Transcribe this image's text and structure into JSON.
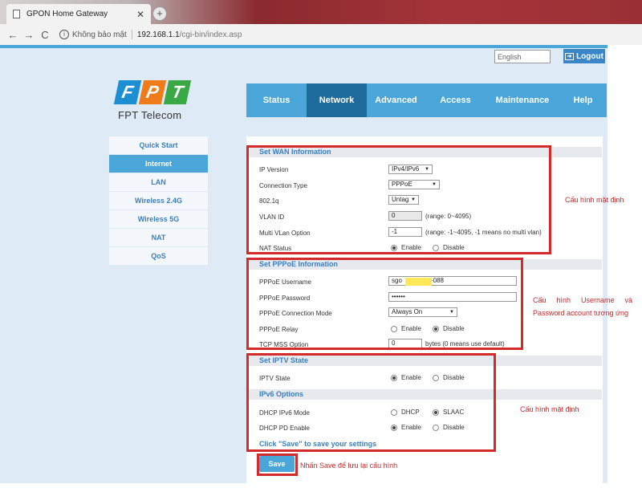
{
  "browser": {
    "tab_title": "GPON Home Gateway",
    "tab_close": "✕",
    "new_tab": "+",
    "back": "←",
    "forward": "→",
    "reload": "C",
    "info": "i",
    "security_text": "Không bảo mật",
    "url_host": "192.168.1.1",
    "url_path": "/cgi-bin/index.asp"
  },
  "header": {
    "language_value": "English",
    "logout_label": "Logout",
    "logo_letters": [
      "F",
      "P",
      "T"
    ],
    "logo_colors": [
      "#1c8fd3",
      "#ef7c1a",
      "#3aa845"
    ],
    "brand_name": "FPT Telecom"
  },
  "nav": {
    "items": [
      {
        "label": "Status"
      },
      {
        "label": "Network"
      },
      {
        "label": "Advanced"
      },
      {
        "label": "Access"
      },
      {
        "label": "Maintenance"
      },
      {
        "label": "Help"
      }
    ],
    "active": "Network"
  },
  "sidebar": {
    "items": [
      {
        "label": "Quick Start"
      },
      {
        "label": "Internet"
      },
      {
        "label": "LAN"
      },
      {
        "label": "Wireless 2.4G"
      },
      {
        "label": "Wireless 5G"
      },
      {
        "label": "NAT"
      },
      {
        "label": "QoS"
      }
    ],
    "active": "Internet"
  },
  "wan": {
    "title": "Set WAN Information",
    "ip_version": {
      "label": "IP Version",
      "value": "IPv4/IPv6"
    },
    "connection_type": {
      "label": "Connection Type",
      "value": "PPPoE"
    },
    "dot1q": {
      "label": "802.1q",
      "value": "Untag"
    },
    "vlan_id": {
      "label": "VLAN ID",
      "value": "0",
      "hint": "(range: 0~4095)"
    },
    "multi_vlan": {
      "label": "Multi VLan Option",
      "value": "-1",
      "hint": "(range: -1~4095, -1 means no multi vlan)"
    },
    "nat_status": {
      "label": "NAT Status",
      "enable": "Enable",
      "disable": "Disable",
      "selected": "Enable"
    }
  },
  "pppoe": {
    "title": "Set PPPoE Information",
    "username": {
      "label": "PPPoE Username",
      "value_prefix": "sgo",
      "value_suffix": "-088"
    },
    "password": {
      "label": "PPPoE Password",
      "value": "••••••"
    },
    "connection_mode": {
      "label": "PPPoE Connection Mode",
      "value": "Always On"
    },
    "relay": {
      "label": "PPPoE Relay",
      "enable": "Enable",
      "disable": "Disable",
      "selected": "Disable"
    },
    "tcp_mss": {
      "label": "TCP MSS Option",
      "value": "0",
      "hint": "bytes  (0 means use default)"
    }
  },
  "iptv": {
    "title": "Set IPTV State",
    "state": {
      "label": "IPTV State",
      "enable": "Enable",
      "disable": "Disable",
      "selected": "Enable"
    }
  },
  "ipv6": {
    "title": "IPv6 Options",
    "dhcp_mode": {
      "label": "DHCP IPv6 Mode",
      "option_a": "DHCP",
      "option_b": "SLAAC",
      "selected": "SLAAC"
    },
    "pd_enable": {
      "label": "DHCP PD Enable",
      "enable": "Enable",
      "disable": "Disable",
      "selected": "Enable"
    }
  },
  "save": {
    "hint": "Click \"Save\" to save your settings",
    "label": "Save"
  },
  "annotations": {
    "wan_note": "Cấu hình mặt định",
    "pppoe_note": "Cấu hình Username và Password account tương ứng",
    "iptv_note": "Cấu hình mặt định",
    "save_note": "Nhấn Save để lưu lại cấu hình",
    "color": "#d42a2a"
  }
}
